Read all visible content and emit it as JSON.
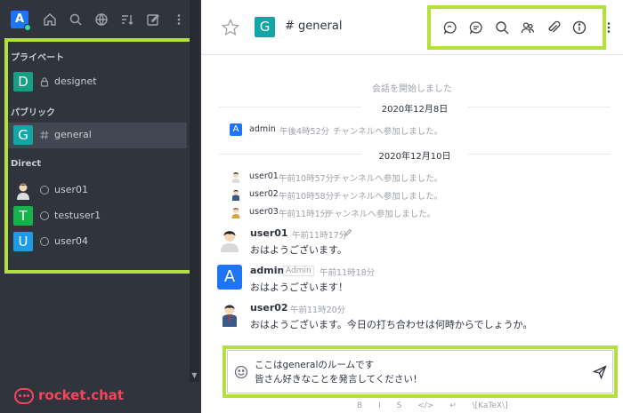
{
  "sidebar": {
    "avatar_letter": "A",
    "toolbar_icons": [
      "home-icon",
      "search-icon",
      "directory-icon",
      "sort-icon",
      "create-new-icon",
      "kebab-menu-icon"
    ],
    "sections": {
      "private": "プライベート",
      "public": "パブリック",
      "direct": "Direct"
    },
    "rooms": [
      {
        "avatar": "D",
        "color": "#14a085",
        "icon": "lock-icon",
        "name": "designet"
      },
      {
        "avatar": "G",
        "color": "#12a6a6",
        "icon": "hash-icon",
        "name": "general",
        "active": true
      },
      {
        "avatar": "",
        "color": "#ffffff",
        "icon": "status-icon",
        "name": "user01"
      },
      {
        "avatar": "T",
        "color": "#15b34a",
        "icon": "status-icon",
        "name": "testuser1"
      },
      {
        "avatar": "U",
        "color": "#1d9ce5",
        "icon": "status-icon",
        "name": "user04"
      }
    ],
    "brand": "rocket.chat"
  },
  "header": {
    "avatar": "G",
    "title": "general",
    "tool_icons": [
      "discussion-icon",
      "threads-icon",
      "search-icon",
      "members-icon",
      "attachment-icon",
      "info-icon",
      "kebab-menu-icon"
    ]
  },
  "messages": {
    "start_note": "会話を開始しました",
    "date1": "2020年12月8日",
    "sys1": {
      "user": "admin",
      "time": "午後4時52分",
      "text": "チャンネルへ参加しました。"
    },
    "date2": "2020年12月10日",
    "sys2": {
      "user": "user01",
      "time": "午前10時57分",
      "text": "チャンネルへ参加しました。"
    },
    "sys3": {
      "user": "user02",
      "time": "午前10時58分",
      "text": "チャンネルへ参加しました。"
    },
    "sys4": {
      "user": "user03",
      "time": "午前11時1分",
      "text": "チャンネルへ参加しました。"
    },
    "m1": {
      "user": "user01",
      "time": "午前11時17分",
      "body": "おはようございます。"
    },
    "m2": {
      "user": "admin",
      "role": "Admin",
      "time": "午前11時18分",
      "body": "おはようございます！"
    },
    "m3": {
      "user": "user02",
      "time": "午前11時20分",
      "body": "おはようございます。今日の打ち合わせは何時からでしょうか。"
    }
  },
  "composer": {
    "line1": "ここはgeneralのルームです",
    "line2": "皆さん好きなことを発言してください！",
    "format": [
      "B",
      "I",
      "S",
      "</>",
      "↵",
      "\\[KaTeX\\]"
    ]
  },
  "colors": {
    "accent_frame": "#b4e03c",
    "sidebar_bg": "#2f343d",
    "brand": "#f5455c"
  }
}
